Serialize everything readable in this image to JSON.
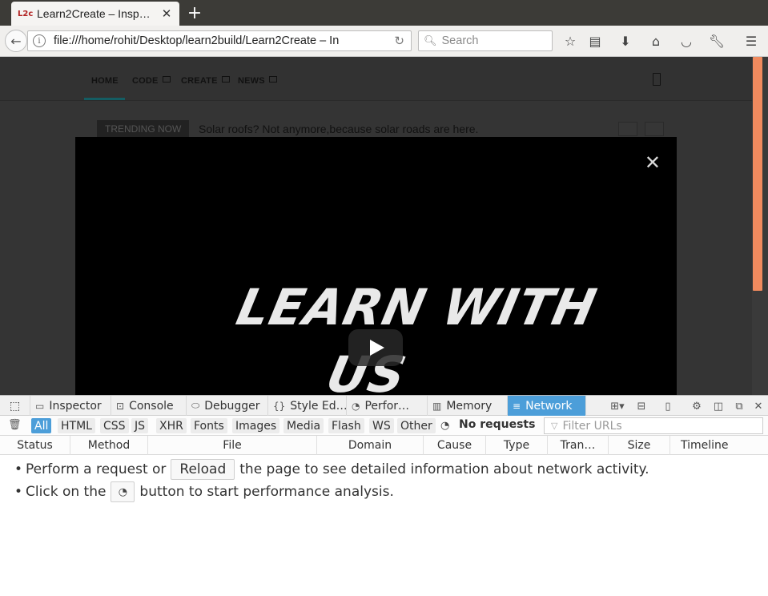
{
  "browser": {
    "tab_title": "Learn2Create – Insp…",
    "favicon_text": "L2c",
    "url": "file:///home/rohit/Desktop/learn2build/Learn2Create – In",
    "search_placeholder": "Search"
  },
  "site": {
    "nav_items": [
      "HOME",
      "CODE",
      "CREATE",
      "NEWS"
    ],
    "trending_label": "TRENDING NOW",
    "trending_text": "Solar roofs? Not anymore,because solar roads are here.",
    "video_title_line1": "LEARN WITH",
    "video_title_line2": "US",
    "close_glyph": "✕",
    "scroll_accent": "#f08a5e"
  },
  "devtools": {
    "tabs": [
      {
        "label": "Inspector",
        "icon": "inspector-icon"
      },
      {
        "label": "Console",
        "icon": "console-icon"
      },
      {
        "label": "Debugger",
        "icon": "debugger-icon"
      },
      {
        "label": "Style Ed…",
        "icon": "style-editor-icon"
      },
      {
        "label": "Perfor…",
        "icon": "performance-icon"
      },
      {
        "label": "Memory",
        "icon": "memory-icon"
      },
      {
        "label": "Network",
        "icon": "network-icon",
        "active": true
      }
    ],
    "filters": [
      "All",
      "HTML",
      "CSS",
      "JS",
      "XHR",
      "Fonts",
      "Images",
      "Media",
      "Flash",
      "WS",
      "Other"
    ],
    "active_filter": "All",
    "no_requests": "No requests",
    "filter_placeholder": "Filter URLs",
    "columns": [
      "Status",
      "Method",
      "File",
      "Domain",
      "Cause",
      "Type",
      "Tran…",
      "Size",
      "Timeline"
    ],
    "message1_before": "Perform a request or",
    "message1_button": "Reload",
    "message1_after": "the page to see detailed information about network activity.",
    "message2_before": "Click on the",
    "message2_after": "button to start performance analysis.",
    "accent_color": "#4c9ed9"
  }
}
